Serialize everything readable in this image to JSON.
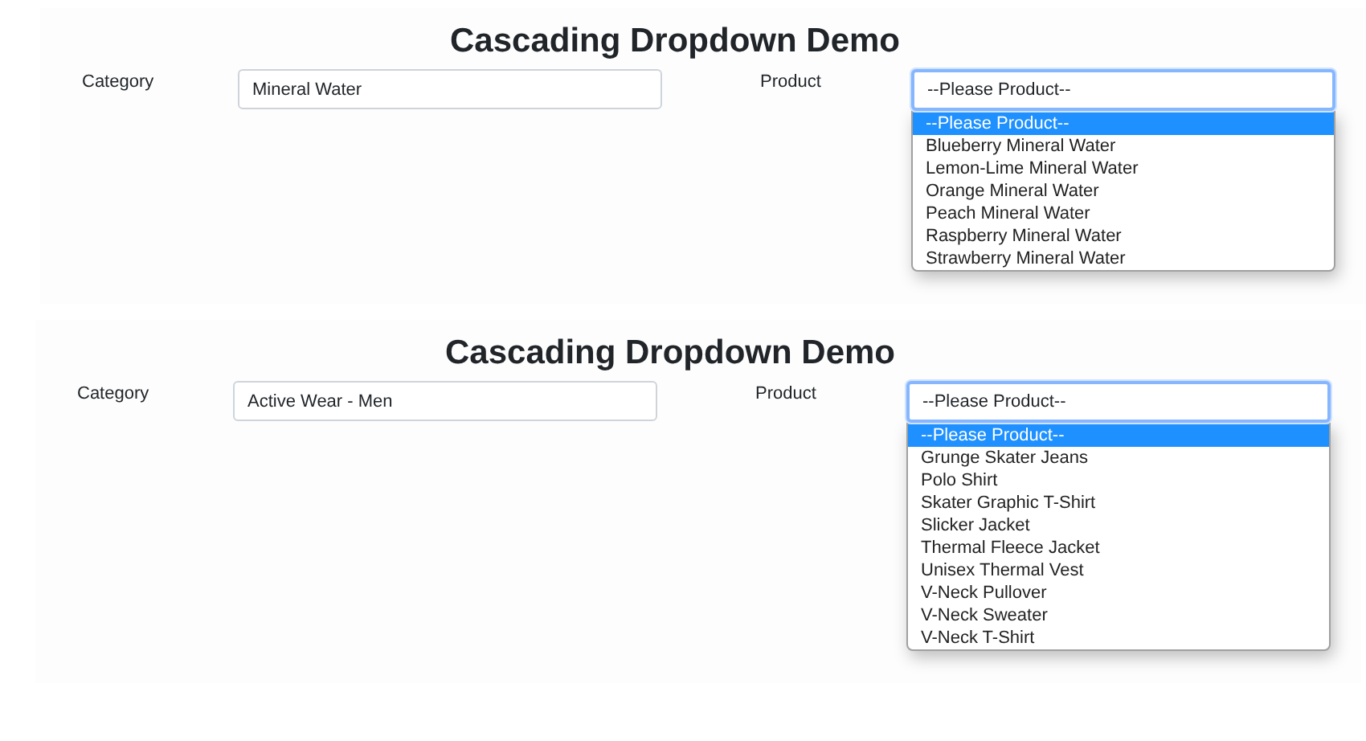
{
  "panels": [
    {
      "title": "Cascading Dropdown Demo",
      "category": {
        "label": "Category",
        "value": "Mineral Water"
      },
      "product": {
        "label": "Product",
        "value": "--Please Product--",
        "focused": true,
        "options": [
          {
            "label": "--Please Product--",
            "selected": true
          },
          {
            "label": "Blueberry Mineral Water",
            "selected": false
          },
          {
            "label": "Lemon-Lime Mineral Water",
            "selected": false
          },
          {
            "label": "Orange Mineral Water",
            "selected": false
          },
          {
            "label": "Peach Mineral Water",
            "selected": false
          },
          {
            "label": "Raspberry Mineral Water",
            "selected": false
          },
          {
            "label": "Strawberry Mineral Water",
            "selected": false
          }
        ]
      }
    },
    {
      "title": "Cascading Dropdown Demo",
      "category": {
        "label": "Category",
        "value": "Active Wear - Men"
      },
      "product": {
        "label": "Product",
        "value": "--Please Product--",
        "focused": true,
        "options": [
          {
            "label": "--Please Product--",
            "selected": true
          },
          {
            "label": "Grunge Skater Jeans",
            "selected": false
          },
          {
            "label": "Polo Shirt",
            "selected": false
          },
          {
            "label": "Skater Graphic T-Shirt",
            "selected": false
          },
          {
            "label": "Slicker Jacket",
            "selected": false
          },
          {
            "label": "Thermal Fleece Jacket",
            "selected": false
          },
          {
            "label": "Unisex Thermal Vest",
            "selected": false
          },
          {
            "label": "V-Neck Pullover",
            "selected": false
          },
          {
            "label": "V-Neck Sweater",
            "selected": false
          },
          {
            "label": "V-Neck T-Shirt",
            "selected": false
          }
        ]
      }
    }
  ]
}
